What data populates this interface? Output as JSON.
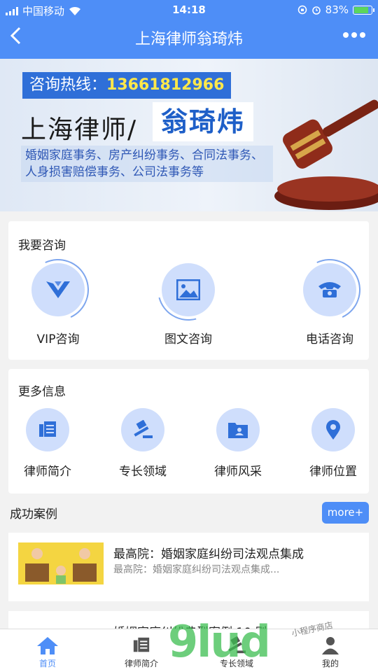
{
  "status": {
    "carrier": "中国移动",
    "time": "14:18",
    "battery": "83%",
    "battery_level": 0.83
  },
  "nav": {
    "title": "上海律师翁琦炜"
  },
  "banner": {
    "hotline_label": "咨询热线：",
    "hotline_number": "13661812966",
    "title": "上海律师/",
    "name": "翁琦炜",
    "desc": "婚姻家庭事务、房产纠纷事务、合同法事务、人身损害赔偿事务、公司法事务等",
    "slides": 2,
    "active_slide": 0
  },
  "consult": {
    "title": "我要咨询",
    "items": [
      {
        "label": "VIP咨询",
        "icon": "vip-icon"
      },
      {
        "label": "图文咨询",
        "icon": "image-icon"
      },
      {
        "label": "电话咨询",
        "icon": "phone-icon"
      }
    ]
  },
  "more_info": {
    "title": "更多信息",
    "items": [
      {
        "label": "律师简介",
        "icon": "document-icon"
      },
      {
        "label": "专长领域",
        "icon": "gavel-icon"
      },
      {
        "label": "律师风采",
        "icon": "folder-person-icon"
      },
      {
        "label": "律师位置",
        "icon": "location-icon"
      }
    ]
  },
  "cases": {
    "title": "成功案例",
    "more_label": "more+",
    "items": [
      {
        "title": "最高院：婚姻家庭纠纷司法观点集成",
        "summary": "最高院：婚姻家庭纠纷司法观点集成..."
      },
      {
        "title": "婚姻家庭纠纷典型案例 10 则",
        "summary": ""
      }
    ]
  },
  "tabbar": {
    "items": [
      {
        "label": "首页",
        "icon": "home-icon",
        "active": true
      },
      {
        "label": "律师简介",
        "icon": "document-icon",
        "active": false
      },
      {
        "label": "专长领域",
        "icon": "gavel-icon",
        "active": false
      },
      {
        "label": "我的",
        "icon": "person-icon",
        "active": false
      }
    ]
  },
  "watermark": {
    "main": "9lud",
    "sub": "小程序商店"
  },
  "colors": {
    "primary": "#4e8ef7",
    "icon_bg": "#cfdefc",
    "icon_fg": "#2f6fd8"
  }
}
